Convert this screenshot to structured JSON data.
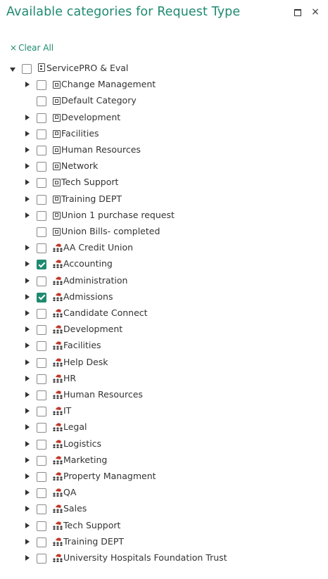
{
  "header": {
    "title": "Available categories for Request Type",
    "maximize_icon": "maximize-icon",
    "close_glyph": "×"
  },
  "clear_all": {
    "glyph": "×",
    "label": "Clear All"
  },
  "colors": {
    "accent": "#1f8a70",
    "team_icon_red": "#c0392b",
    "text": "#333333"
  },
  "tree": {
    "root": {
      "label": "ServicePRO & Eval",
      "icon": "building-icon",
      "expanded": true,
      "checked": false
    },
    "categories": [
      {
        "label": "Change Management",
        "expandable": true,
        "checked": false
      },
      {
        "label": "Default Category",
        "expandable": false,
        "checked": false
      },
      {
        "label": "Development",
        "expandable": true,
        "checked": false
      },
      {
        "label": "Facilities",
        "expandable": true,
        "checked": false
      },
      {
        "label": "Human Resources",
        "expandable": true,
        "checked": false
      },
      {
        "label": "Network",
        "expandable": true,
        "checked": false
      },
      {
        "label": "Tech Support",
        "expandable": true,
        "checked": false
      },
      {
        "label": "Training DEPT",
        "expandable": true,
        "checked": false
      },
      {
        "label": "Union 1 purchase request",
        "expandable": true,
        "checked": false
      },
      {
        "label": "Union Bills- completed",
        "expandable": false,
        "checked": false
      }
    ],
    "teams": [
      {
        "label": "AA Credit Union",
        "checked": false
      },
      {
        "label": "Accounting",
        "checked": true
      },
      {
        "label": "Administration",
        "checked": false
      },
      {
        "label": "Admissions",
        "checked": true
      },
      {
        "label": "Candidate Connect",
        "checked": false
      },
      {
        "label": "Development",
        "checked": false
      },
      {
        "label": "Facilities",
        "checked": false
      },
      {
        "label": "Help Desk",
        "checked": false
      },
      {
        "label": "HR",
        "checked": false
      },
      {
        "label": "Human Resources",
        "checked": false
      },
      {
        "label": "IT",
        "checked": false
      },
      {
        "label": "Legal",
        "checked": false
      },
      {
        "label": "Logistics",
        "checked": false
      },
      {
        "label": "Marketing",
        "checked": false
      },
      {
        "label": "Property Managment",
        "checked": false
      },
      {
        "label": "QA",
        "checked": false
      },
      {
        "label": "Sales",
        "checked": false
      },
      {
        "label": "Tech Support",
        "checked": false
      },
      {
        "label": "Training DEPT",
        "checked": false
      },
      {
        "label": "University Hospitals Foundation Trust",
        "checked": false
      }
    ]
  }
}
